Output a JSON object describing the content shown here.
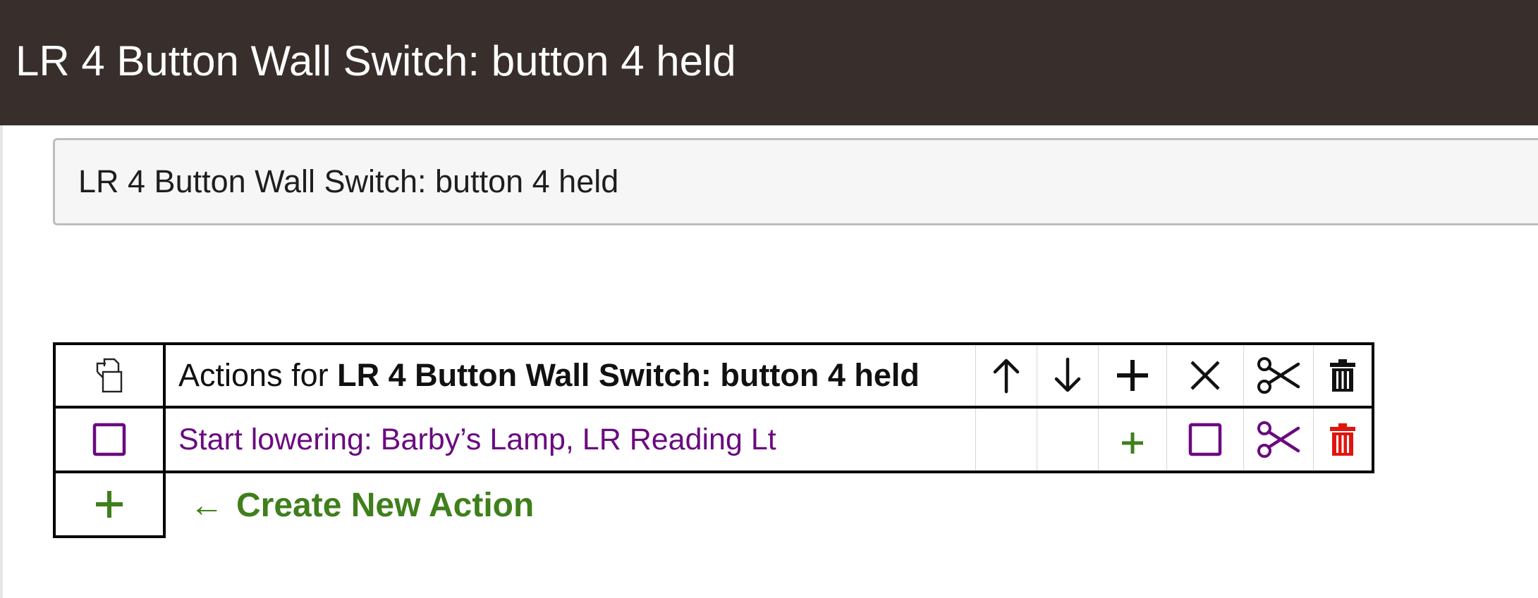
{
  "header": {
    "title": "LR 4 Button Wall Switch: button 4 held"
  },
  "name_field": {
    "value": "LR 4 Button Wall Switch: button 4 held"
  },
  "table": {
    "header_prefix": "Actions for",
    "header_subject": "LR 4 Button Wall Switch: button 4 held",
    "rows": [
      {
        "label": "Start lowering: Barby’s Lamp, LR Reading Lt"
      }
    ]
  },
  "create": {
    "arrow": "←",
    "label": "Create New Action"
  },
  "colors": {
    "titlebar": "#382f2d",
    "link_purple": "#6a0a80",
    "add_green": "#3f7f1c",
    "delete_red": "#e0160e"
  },
  "icons": [
    "copy-icon",
    "arrow-up-icon",
    "arrow-down-icon",
    "plus-icon",
    "close-icon",
    "scissors-icon",
    "trash-icon",
    "checkbox-icon"
  ]
}
